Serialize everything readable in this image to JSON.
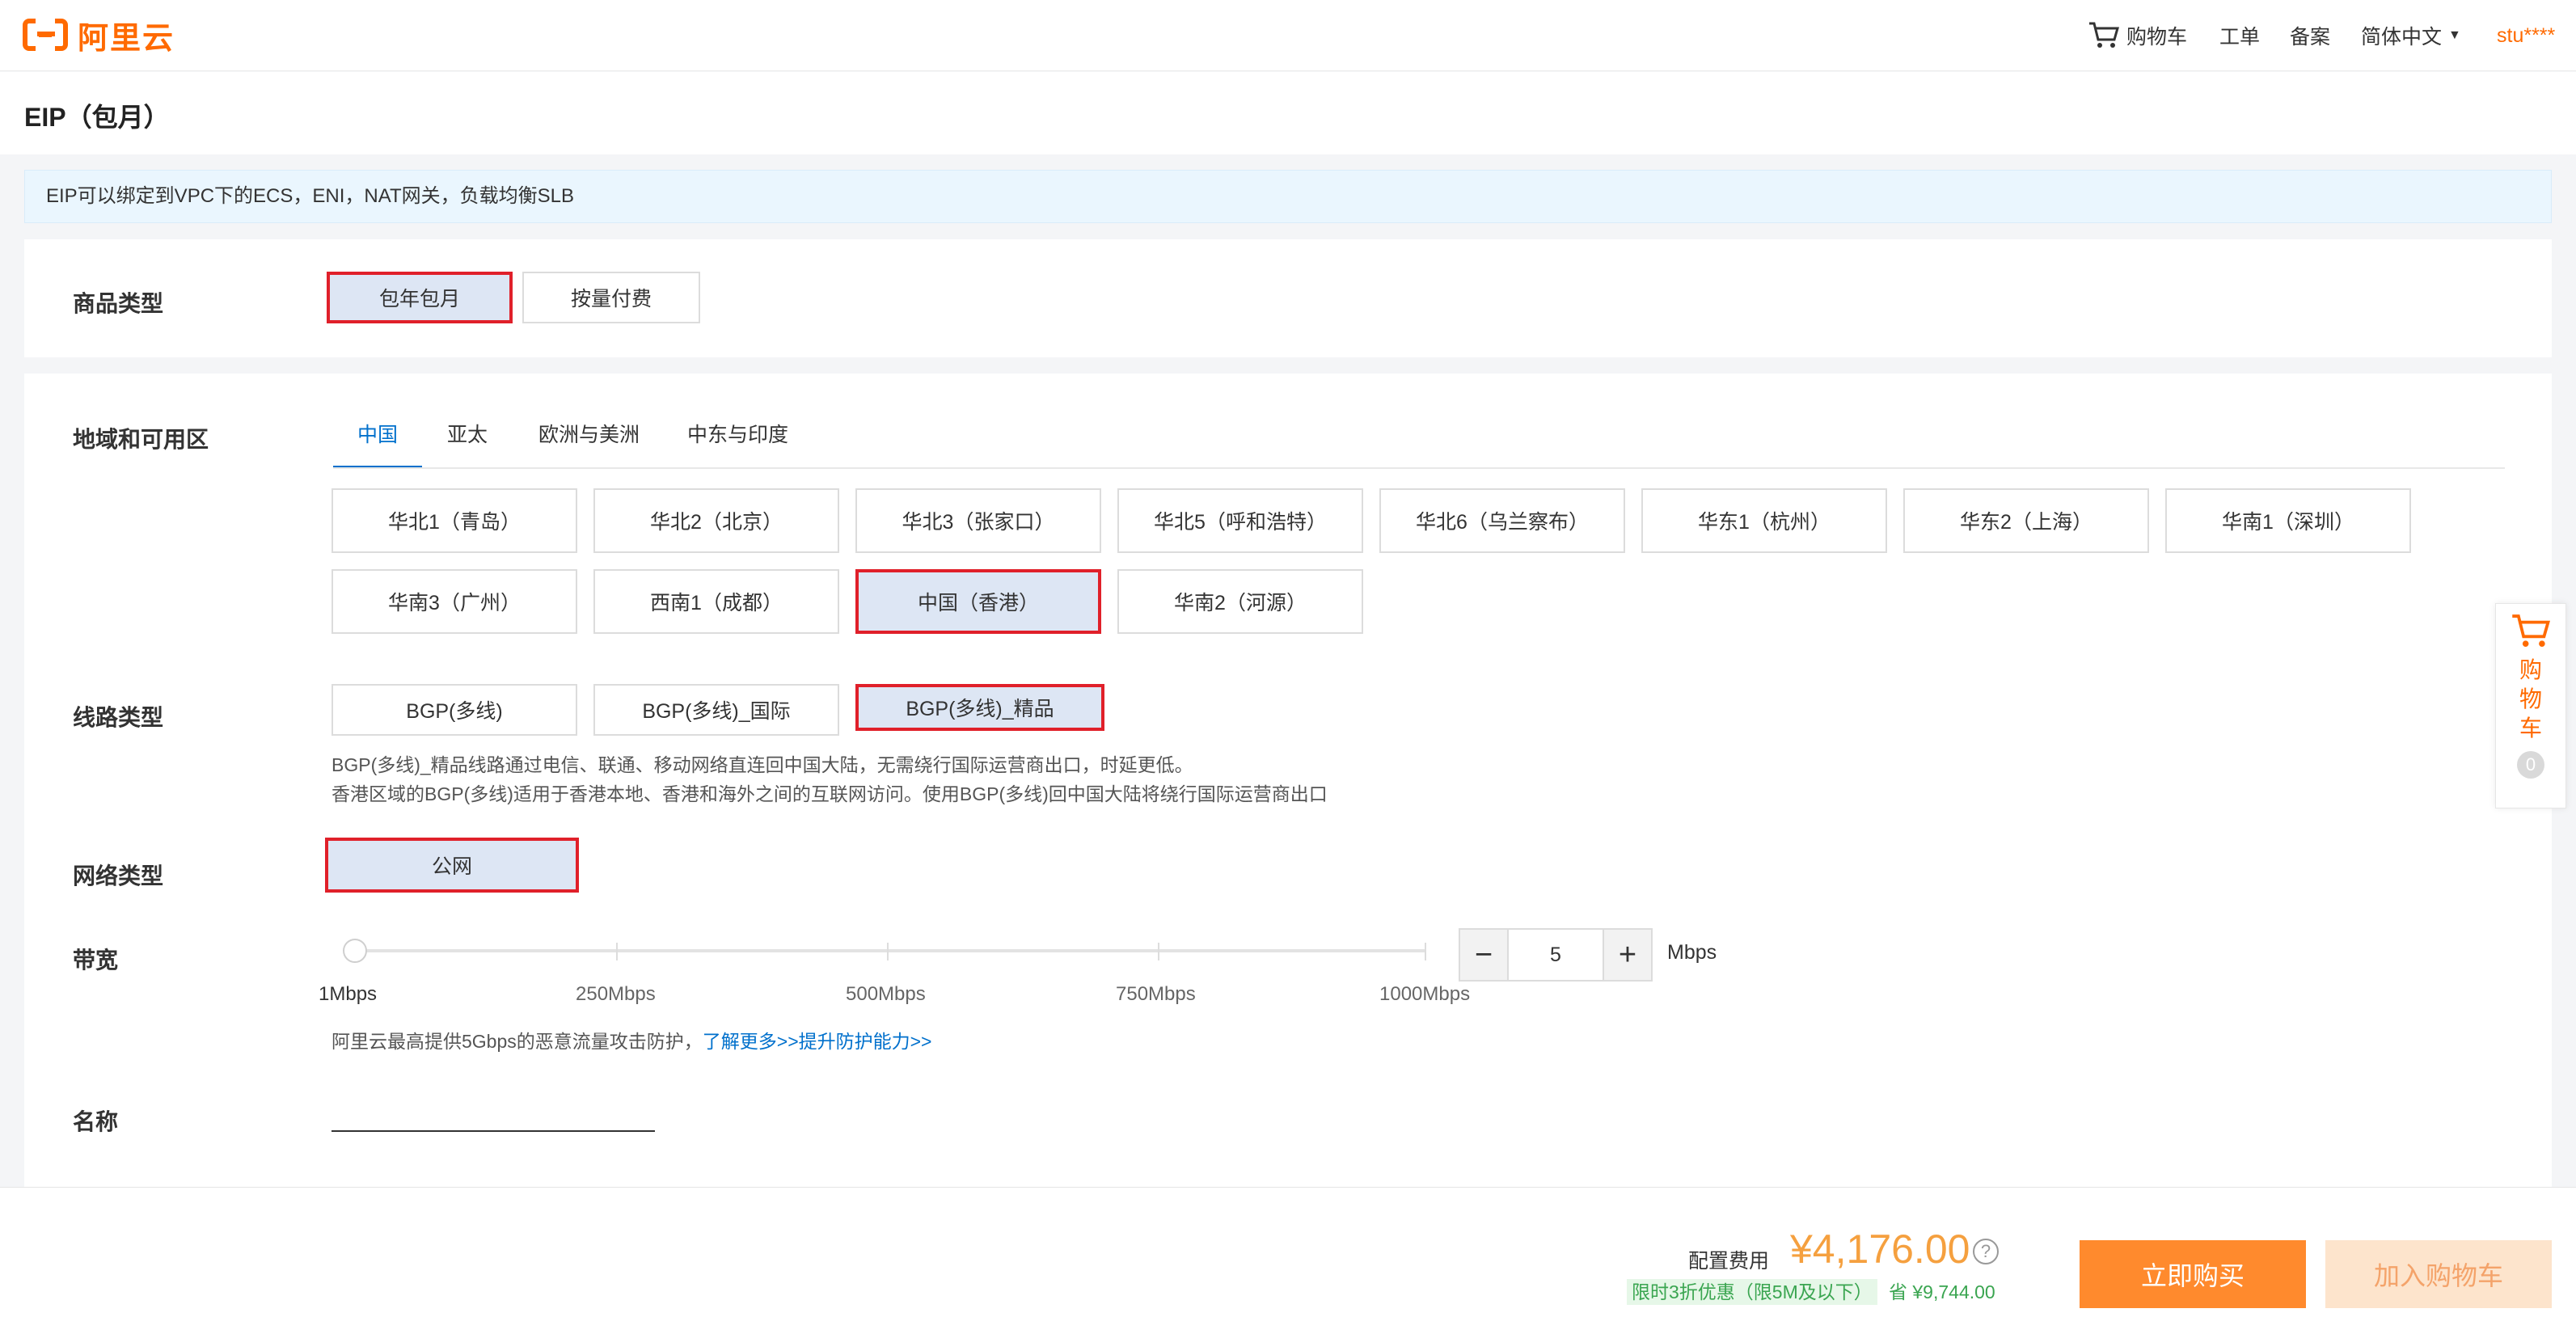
{
  "header": {
    "logo_text": "阿里云",
    "cart_label": "购物车",
    "ticket_label": "工单",
    "filing_label": "备案",
    "language_label": "简体中文",
    "user_label": "stu****"
  },
  "page": {
    "title": "EIP（包月）",
    "notice": "EIP可以绑定到VPC下的ECS，ENI，NAT网关，负载均衡SLB"
  },
  "product_type": {
    "label": "商品类型",
    "options": [
      {
        "label": "包年包月",
        "selected": true
      },
      {
        "label": "按量付费",
        "selected": false
      }
    ]
  },
  "region": {
    "label": "地域和可用区",
    "tabs": [
      {
        "label": "中国",
        "active": true
      },
      {
        "label": "亚太",
        "active": false
      },
      {
        "label": "欧洲与美洲",
        "active": false
      },
      {
        "label": "中东与印度",
        "active": false
      }
    ],
    "options": [
      {
        "label": "华北1（青岛）",
        "selected": false
      },
      {
        "label": "华北2（北京）",
        "selected": false
      },
      {
        "label": "华北3（张家口）",
        "selected": false
      },
      {
        "label": "华北5（呼和浩特）",
        "selected": false
      },
      {
        "label": "华北6（乌兰察布）",
        "selected": false
      },
      {
        "label": "华东1（杭州）",
        "selected": false
      },
      {
        "label": "华东2（上海）",
        "selected": false
      },
      {
        "label": "华南1（深圳）",
        "selected": false
      },
      {
        "label": "华南3（广州）",
        "selected": false
      },
      {
        "label": "西南1（成都）",
        "selected": false
      },
      {
        "label": "中国（香港）",
        "selected": true
      },
      {
        "label": "华南2（河源）",
        "selected": false
      }
    ]
  },
  "line_type": {
    "label": "线路类型",
    "options": [
      {
        "label": "BGP(多线)",
        "selected": false
      },
      {
        "label": "BGP(多线)_国际",
        "selected": false
      },
      {
        "label": "BGP(多线)_精品",
        "selected": true
      }
    ],
    "desc_line1": "BGP(多线)_精品线路通过电信、联通、移动网络直连回中国大陆，无需绕行国际运营商出口，时延更低。",
    "desc_line2": "香港区域的BGP(多线)适用于香港本地、香港和海外之间的互联网访问。使用BGP(多线)回中国大陆将绕行国际运营商出口"
  },
  "network_type": {
    "label": "网络类型",
    "option": "公网"
  },
  "bandwidth": {
    "label": "带宽",
    "ticks": [
      "1Mbps",
      "250Mbps",
      "500Mbps",
      "750Mbps",
      "1000Mbps"
    ],
    "value": "5",
    "slider_fraction": 0.004,
    "unit": "Mbps",
    "minus": "−",
    "plus": "+",
    "tip_text": "阿里云最高提供5Gbps的恶意流量攻击防护，",
    "tip_link": "了解更多>>提升防护能力>>"
  },
  "name_field": {
    "label": "名称",
    "value": ""
  },
  "float_cart": {
    "label": "购物车",
    "count": "0"
  },
  "footer": {
    "cost_label": "配置费用",
    "price": "¥4,176.00",
    "help_icon": "?",
    "promo": "限时3折优惠（限5M及以下）",
    "save": "省 ¥9,744.00",
    "buy_button": "立即购买",
    "cart_button": "加入购物车"
  },
  "colors": {
    "brand": "#ff6a00",
    "link": "#0070cc",
    "selected_border": "#e0202a",
    "selected_bg": "#dde6f4",
    "price": "#f5a03f",
    "buy_button": "#ff8a2d"
  }
}
